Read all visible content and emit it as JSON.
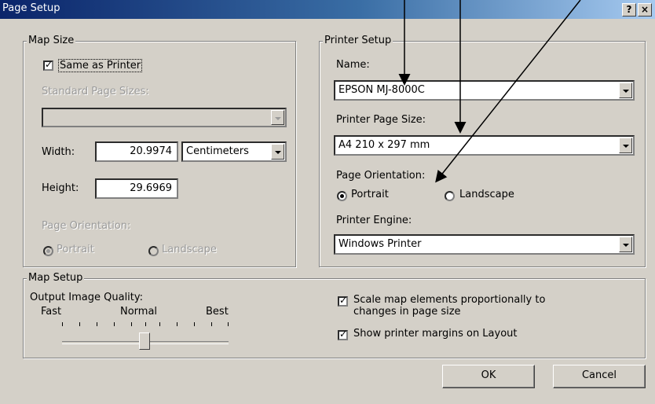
{
  "window": {
    "title": "Page Setup",
    "help_button": "?",
    "close_button": "×"
  },
  "map_size": {
    "group_label": "Map Size",
    "same_as_printer": {
      "label": "Same as Printer",
      "checked": true
    },
    "standard_page_sizes_label": "Standard Page Sizes:",
    "standard_page_sizes_value": "",
    "width_label": "Width:",
    "width_value": "20.9974",
    "units_value": "Centimeters",
    "height_label": "Height:",
    "height_value": "29.6969",
    "orientation_label": "Page Orientation:",
    "portrait_label": "Portrait",
    "landscape_label": "Landscape",
    "orientation_selected": "Portrait"
  },
  "printer_setup": {
    "group_label": "Printer Setup",
    "name_label": "Name:",
    "name_value": "EPSON MJ-8000C",
    "page_size_label": "Printer Page Size:",
    "page_size_value": "A4 210 x 297 mm",
    "orientation_label": "Page Orientation:",
    "portrait_label": "Portrait",
    "landscape_label": "Landscape",
    "orientation_selected": "Portrait",
    "engine_label": "Printer Engine:",
    "engine_value": "Windows Printer"
  },
  "map_setup": {
    "group_label": "Map Setup",
    "quality_label": "Output Image Quality:",
    "fast_label": "Fast",
    "normal_label": "Normal",
    "best_label": "Best",
    "quality_level": 0.5,
    "scale_label_line1": "Scale map elements proportionally to",
    "scale_label_line2": "changes in page size",
    "scale_checked": true,
    "margins_label": "Show printer margins on Layout",
    "margins_checked": true
  },
  "buttons": {
    "ok": "OK",
    "cancel": "Cancel"
  },
  "colors": {
    "title_start": "#0a246a",
    "title_end": "#a6caf0",
    "face": "#d4d0c8",
    "disabled_text": "#9a9a9a"
  }
}
